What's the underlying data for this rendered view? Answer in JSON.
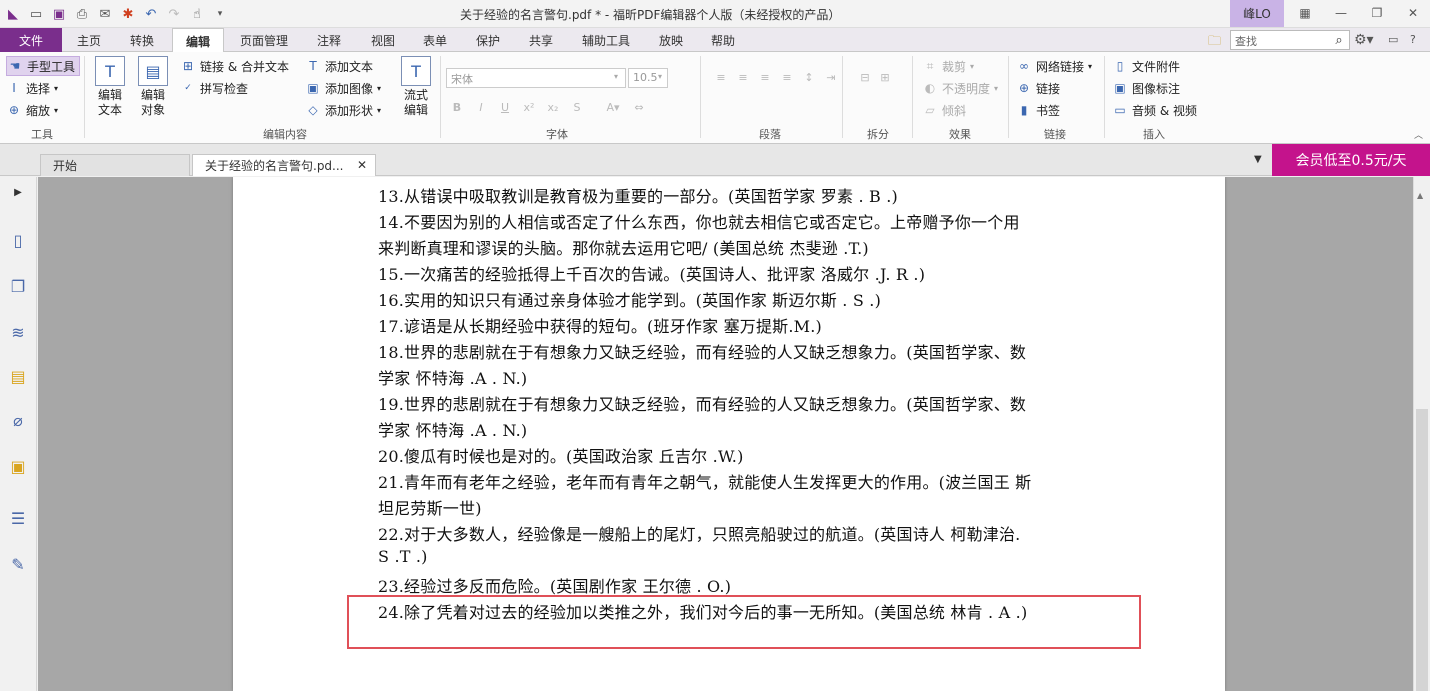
{
  "window": {
    "title": "关于经验的名言警句.pdf * - 福昕PDF编辑器个人版（未经授权的产品）",
    "user": "峰LO",
    "controls": [
      "grid-icon",
      "minimize-icon",
      "restore-icon",
      "close-icon"
    ]
  },
  "menu": {
    "tabs": [
      "文件",
      "主页",
      "转换",
      "编辑",
      "页面管理",
      "注释",
      "视图",
      "表单",
      "保护",
      "共享",
      "辅助工具",
      "放映",
      "帮助"
    ],
    "active": "编辑",
    "search_placeholder": "查找"
  },
  "ribbon": {
    "tools": {
      "hand": "手型工具",
      "select": "选择",
      "zoom": "缩放",
      "label": "工具"
    },
    "edit_text": "编辑\n文本",
    "edit_object": "编辑\n对象",
    "link_merge": "链接 & 合并文本",
    "spellcheck": "拼写检查",
    "add_text": "添加文本",
    "add_image": "添加图像",
    "add_shape": "添加形状",
    "flow_edit": "流式\n编辑",
    "edit_content_label": "编辑内容",
    "font_name": "宋体",
    "font_size": "10.5",
    "font_label": "字体",
    "paragraph_label": "段落",
    "split_label": "拆分",
    "crop": "裁剪",
    "opacity": "不透明度",
    "skew": "倾斜",
    "effect_label": "效果",
    "weblink": "网络链接",
    "link": "链接",
    "bookmark": "书签",
    "link_label": "链接",
    "file_attachment": "文件附件",
    "image_annotation": "图像标注",
    "audio_video": "音频 & 视频",
    "insert_label": "插入"
  },
  "doc_tabs": {
    "start": "开始",
    "file": "关于经验的名言警句.pd...",
    "promo": "会员低至0.5元/天"
  },
  "document": {
    "lines": [
      "13.从错误中吸取教训是教育极为重要的一部分。(英国哲学家  罗素  . B .)",
      "14.不要因为别的人相信或否定了什么东西，你也就去相信它或否定它。上帝赠予你一个用",
      "来判断真理和谬误的头脑。那你就去运用它吧/ (美国总统  杰斐逊  .T.)",
      "15.一次痛苦的经验抵得上千百次的告诫。(英国诗人、批评家  洛威尔  .J. R .)",
      "16.实用的知识只有通过亲身体验才能学到。(英国作家  斯迈尔斯  . S .)",
      "17.谚语是从长期经验中获得的短句。(班牙作家  塞万提斯.M.)",
      "18.世界的悲剧就在于有想象力又缺乏经验，而有经验的人又缺乏想象力。(英国哲学家、数",
      "学家  怀特海  .A . N.)",
      "19.世界的悲剧就在于有想象力又缺乏经验，而有经验的人又缺乏想象力。(英国哲学家、数",
      "学家  怀特海  .A . N.)",
      "20.傻瓜有时候也是对的。(英国政治家  丘吉尔  .W.)",
      "21.青年而有老年之经验，老年而有青年之朝气，就能使人生发挥更大的作用。(波兰国王  斯",
      "坦尼劳斯一世)",
      "22.对于大多数人，经验像是一艘船上的尾灯，只照亮船驶过的航道。(英国诗人  柯勒津治.",
      "S .T .)",
      "23.经验过多反而危险。(英国剧作家  王尔德  . O.)",
      "24.除了凭着对过去的经验加以类推之外，我们对今后的事一无所知。(美国总统  林肯  . A .)"
    ]
  },
  "colors": {
    "file_tab": "#7a2e8c",
    "promo": "#c4138c",
    "highlight": "#e05058"
  }
}
